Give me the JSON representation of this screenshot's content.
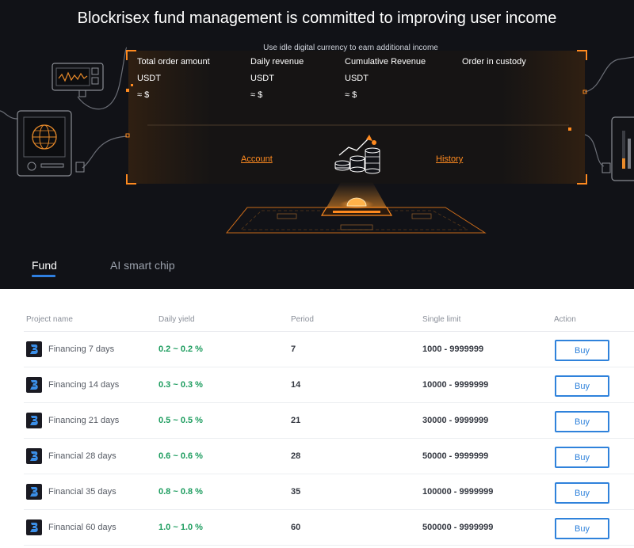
{
  "hero": {
    "title": "Blockrisex fund management is committed to improving user income",
    "subtitle": "Use idle digital currency to earn additional income",
    "accent_color": "#ff8a1f",
    "stats": [
      {
        "label": "Total order amount",
        "unit": "USDT",
        "approx": "≈ $"
      },
      {
        "label": "Daily revenue",
        "unit": "USDT",
        "approx": "≈ $"
      },
      {
        "label": "Cumulative Revenue",
        "unit": "USDT",
        "approx": "≈ $"
      },
      {
        "label": "Order in custody"
      }
    ],
    "account_link": "Account",
    "history_link": "History"
  },
  "tabs": [
    {
      "label": "Fund",
      "active": true
    },
    {
      "label": "AI smart chip",
      "active": false
    }
  ],
  "table": {
    "headers": [
      "Project name",
      "Daily yield",
      "Period",
      "Single limit",
      "Action"
    ],
    "rows": [
      {
        "name": "Financing 7 days",
        "yield": "0.2 ~ 0.2 %",
        "period": "7",
        "limit": "1000 - 9999999",
        "action": "Buy"
      },
      {
        "name": "Financing 14 days",
        "yield": "0.3 ~ 0.3 %",
        "period": "14",
        "limit": "10000 - 9999999",
        "action": "Buy"
      },
      {
        "name": "Financing 21 days",
        "yield": "0.5 ~ 0.5 %",
        "period": "21",
        "limit": "30000 - 9999999",
        "action": "Buy"
      },
      {
        "name": "Financial 28 days",
        "yield": "0.6 ~ 0.6 %",
        "period": "28",
        "limit": "50000 - 9999999",
        "action": "Buy"
      },
      {
        "name": "Financial 35 days",
        "yield": "0.8 ~ 0.8 %",
        "period": "35",
        "limit": "100000 - 9999999",
        "action": "Buy"
      },
      {
        "name": "Financial 60 days",
        "yield": "1.0 ~ 1.0 %",
        "period": "60",
        "limit": "500000 - 9999999",
        "action": "Buy"
      }
    ]
  },
  "colors": {
    "yield": "#1c9c5e",
    "button": "#2f82db",
    "tab_underline": "#2f7fe0"
  },
  "icons": [
    "fund-logo-icon",
    "monitor-device-icon",
    "globe-device-icon",
    "coin-growth-icon",
    "platform-chip-icon"
  ]
}
